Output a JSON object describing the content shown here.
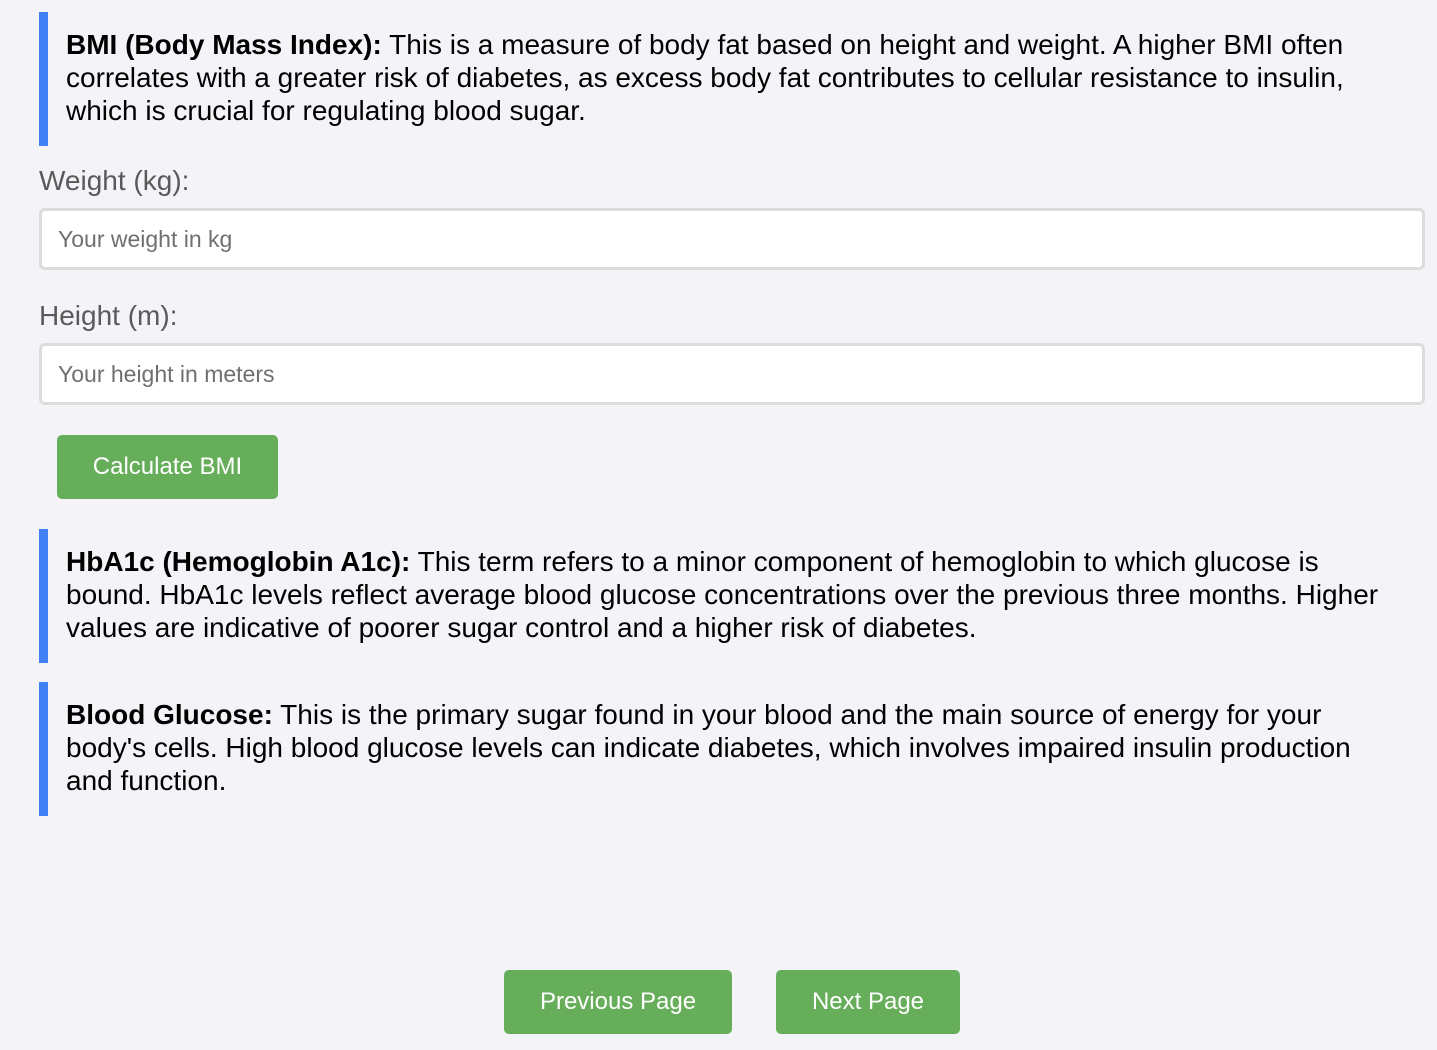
{
  "bmi_info": {
    "term": "BMI (Body Mass Index):",
    "text": " This is a measure of body fat based on height and weight. A higher BMI often correlates with a greater risk of diabetes, as excess body fat contributes to cellular resistance to insulin, which is crucial for regulating blood sugar."
  },
  "form": {
    "weight_label": "Weight (kg):",
    "weight_placeholder": "Your weight in kg",
    "height_label": "Height (m):",
    "height_placeholder": "Your height in meters",
    "calculate_label": "Calculate BMI"
  },
  "hba1c_info": {
    "term": "HbA1c (Hemoglobin A1c):",
    "text": " This term refers to a minor component of hemoglobin to which glucose is bound. HbA1c levels reflect average blood glucose concentrations over the previous three months. Higher values are indicative of poorer sugar control and a higher risk of diabetes."
  },
  "glucose_info": {
    "term": "Blood Glucose:",
    "text": " This is the primary sugar found in your blood and the main source of energy for your body's cells. High blood glucose levels can indicate diabetes, which involves impaired insulin production and function."
  },
  "nav": {
    "previous_label": "Previous Page",
    "next_label": "Next Page"
  },
  "colors": {
    "accent_border": "#3f80f5",
    "button_green": "#67ae5b",
    "background": "#f4f4f8"
  }
}
